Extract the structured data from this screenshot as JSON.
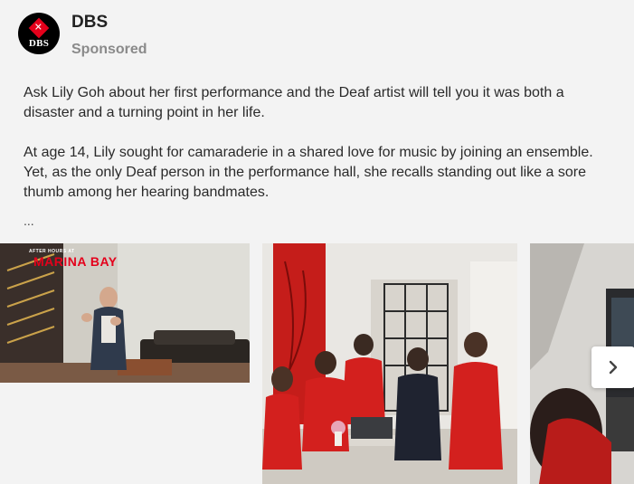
{
  "post": {
    "page_name": "DBS",
    "sponsored_label": "Sponsored",
    "avatar_letters": "DBS",
    "avatar_symbol": "✕",
    "paragraphs": [
      "Ask Lily Goh about her first performance and the Deaf artist will tell you it was both a disaster and a turning point in her life.",
      "At age 14, Lily sought for camaraderie in a shared love for music by joining an ensemble. Yet, as the only Deaf person in the performance hall, she recalls standing out like a sore thumb among her hearing bandmates."
    ],
    "ellipsis": "..."
  },
  "carousel": {
    "card1_title": "MARINA BAY",
    "card1_kicker": "AFTER HOURS AT",
    "next_icon": "chevron-right-icon"
  },
  "colors": {
    "brand_red": "#e4001b",
    "background": "#f3f3f3"
  }
}
